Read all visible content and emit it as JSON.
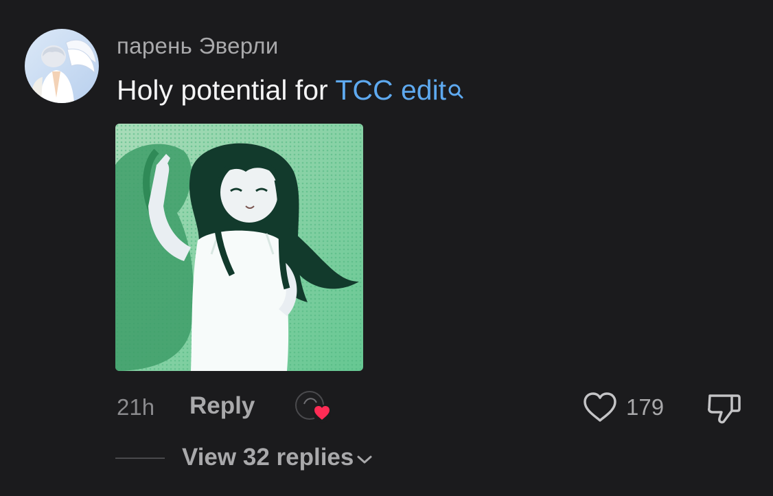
{
  "comment": {
    "username": "парень Эверли",
    "text": "Holy potential for ",
    "link_text": "TCC edit",
    "time": "21h",
    "reply_label": "Reply",
    "like_count": "179",
    "view_replies_label": "View 32 replies"
  },
  "icons": {
    "search": "search-icon",
    "heart": "heart-outline-icon",
    "dislike": "thumbs-down-icon",
    "chevron": "chevron-down-icon",
    "creator_heart": "creator-liked-heart-icon"
  },
  "colors": {
    "background": "#1b1b1d",
    "link": "#5ea9ef",
    "secondary_text": "#a9a9ab",
    "creator_heart": "#fe2c55",
    "image_green": "#5cc08a"
  }
}
